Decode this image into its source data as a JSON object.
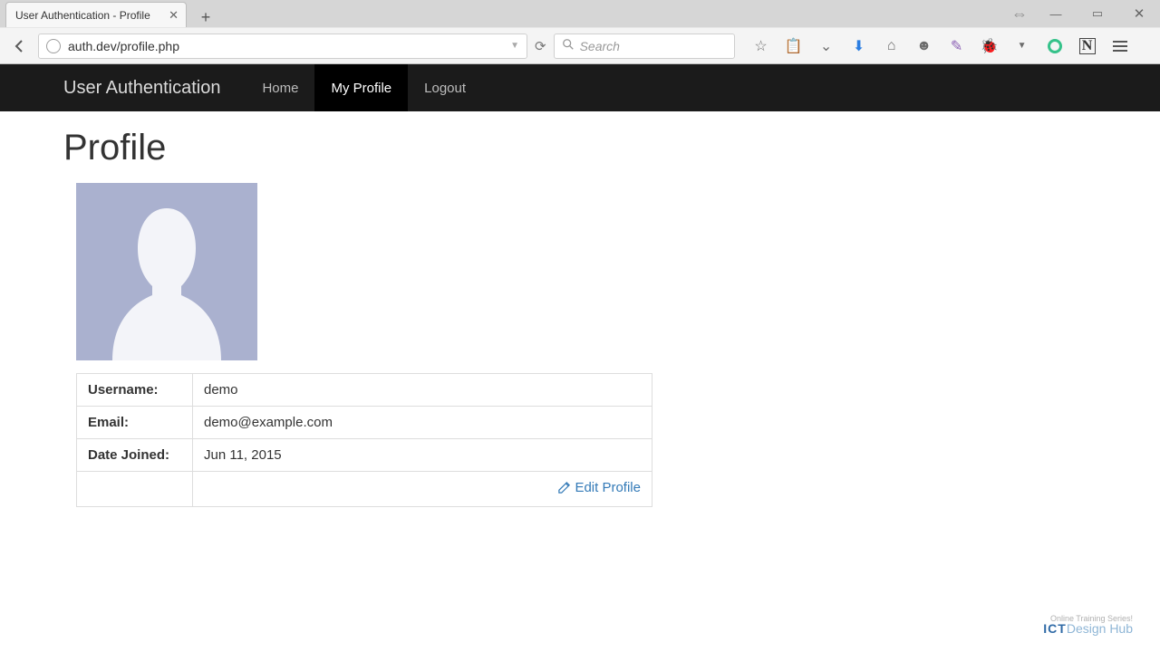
{
  "browser": {
    "tab_title": "User Authentication - Profile",
    "url": "auth.dev/profile.php",
    "search_placeholder": "Search"
  },
  "nav": {
    "brand": "User Authentication",
    "items": [
      {
        "label": "Home",
        "active": false
      },
      {
        "label": "My Profile",
        "active": true
      },
      {
        "label": "Logout",
        "active": false
      }
    ]
  },
  "page": {
    "heading": "Profile",
    "fields": [
      {
        "label": "Username:",
        "value": "demo"
      },
      {
        "label": "Email:",
        "value": "demo@example.com"
      },
      {
        "label": "Date Joined:",
        "value": "Jun 11, 2015"
      }
    ],
    "edit_label": "Edit Profile"
  },
  "watermark": {
    "sub": "Online Training Series!",
    "main1": "ICT",
    "main2": "Design Hub"
  }
}
